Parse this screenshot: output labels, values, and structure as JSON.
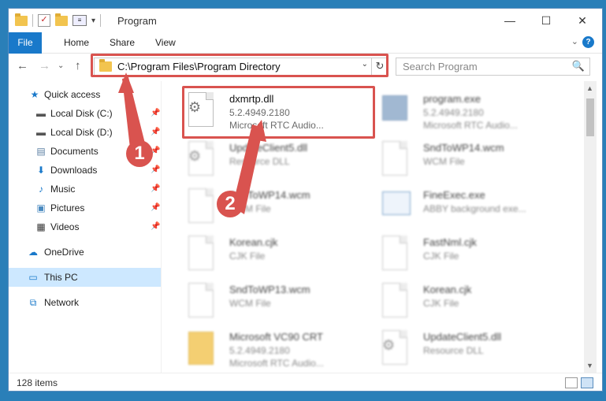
{
  "window": {
    "title": "Program",
    "minimize_glyph": "—",
    "maximize_glyph": "☐",
    "close_glyph": "✕"
  },
  "ribbon": {
    "tabs": [
      "File",
      "Home",
      "Share",
      "View"
    ],
    "help_glyph": "?",
    "expand_glyph": "⌄"
  },
  "address": {
    "path": "C:\\Program Files\\Program Directory",
    "dropdown_glyph": "⌄",
    "refresh_glyph": "↻",
    "back_glyph": "←",
    "forward_glyph": "→",
    "recent_glyph": "⌄",
    "up_glyph": "↑"
  },
  "search": {
    "placeholder": "Search Program",
    "icon": "🔍"
  },
  "sidebar": {
    "quick_access": "Quick access",
    "items": [
      {
        "label": "Local Disk (C:)",
        "icon": "drive-icon"
      },
      {
        "label": "Local Disk (D:)",
        "icon": "drive-icon"
      },
      {
        "label": "Documents",
        "icon": "documents-icon"
      },
      {
        "label": "Downloads",
        "icon": "downloads-icon"
      },
      {
        "label": "Music",
        "icon": "music-icon"
      },
      {
        "label": "Pictures",
        "icon": "pictures-icon"
      },
      {
        "label": "Videos",
        "icon": "videos-icon"
      }
    ],
    "onedrive": "OneDrive",
    "this_pc": "This PC",
    "network": "Network"
  },
  "files": [
    {
      "name": "dxmrtp.dll",
      "line2": "5.2.4949.2180",
      "line3": "Microsoft RTC Audio...",
      "type": "dll"
    },
    {
      "name": "program.exe",
      "line2": "5.2.4949.2180",
      "line3": "Microsoft RTC Audio...",
      "type": "exe"
    },
    {
      "name": "UpdateClient5.dll",
      "line2": "Resource DLL",
      "line3": "",
      "type": "dll"
    },
    {
      "name": "SndToWP14.wcm",
      "line2": "WCM File",
      "line3": "",
      "type": "doc"
    },
    {
      "name": "SndToWP14.wcm",
      "line2": "WCM File",
      "line3": "",
      "type": "doc"
    },
    {
      "name": "FineExec.exe",
      "line2": "ABBY background exe...",
      "line3": "",
      "type": "app"
    },
    {
      "name": "Korean.cjk",
      "line2": "CJK File",
      "line3": "",
      "type": "doc"
    },
    {
      "name": "FastNml.cjk",
      "line2": "CJK File",
      "line3": "",
      "type": "doc"
    },
    {
      "name": "SndToWP13.wcm",
      "line2": "WCM File",
      "line3": "",
      "type": "doc"
    },
    {
      "name": "Korean.cjk",
      "line2": "CJK File",
      "line3": "",
      "type": "doc"
    },
    {
      "name": "Microsoft VC90 CRT",
      "line2": "5.2.4949.2180",
      "line3": "Microsoft RTC Audio...",
      "type": "folder"
    },
    {
      "name": "UpdateClient5.dll",
      "line2": "Resource DLL",
      "line3": "",
      "type": "dll"
    }
  ],
  "status": {
    "item_count": "128 items"
  },
  "annotations": {
    "step1": "1",
    "step2": "2",
    "highlight_color": "#d9534f"
  }
}
